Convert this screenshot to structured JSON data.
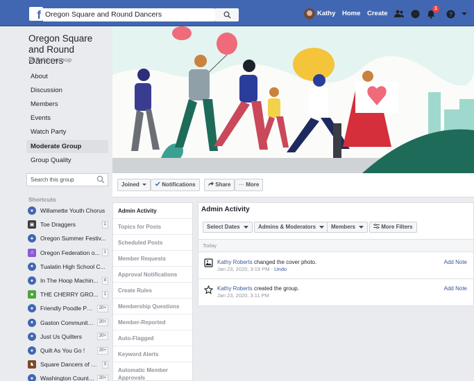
{
  "topbar": {
    "search_value": "Oregon Square and Round Dancers",
    "user_name": "Kathy",
    "home_label": "Home",
    "create_label": "Create",
    "notification_count": "1",
    "brand_color": "#4267b2"
  },
  "group": {
    "name": "Oregon Square and Round Dancers",
    "privacy": "Public group"
  },
  "nav": [
    {
      "label": "About"
    },
    {
      "label": "Discussion"
    },
    {
      "label": "Members"
    },
    {
      "label": "Events"
    },
    {
      "label": "Watch Party"
    },
    {
      "label": "Moderate Group"
    },
    {
      "label": "Group Quality"
    }
  ],
  "sidebar_search_placeholder": "Search this group",
  "shortcuts": {
    "heading": "Shortcuts",
    "items": [
      {
        "label": "Willamette Youth Chorus",
        "count": "",
        "icon": "group-icon"
      },
      {
        "label": "Toe Draggers",
        "count": "1",
        "icon": "photo-icon"
      },
      {
        "label": "Oregon Summer Festiv...",
        "count": "",
        "icon": "group-icon"
      },
      {
        "label": "Oregon Federation o...",
        "count": "1",
        "icon": "music-icon"
      },
      {
        "label": "Tualatin High School C...",
        "count": "",
        "icon": "group-icon"
      },
      {
        "label": "In The Hoop Machin...",
        "count": "4",
        "icon": "group-icon"
      },
      {
        "label": "THE CHERRY GRO...",
        "count": "1",
        "icon": "tree-icon"
      },
      {
        "label": "Friendly Poodle Pe...",
        "count": "20+",
        "icon": "group-icon"
      },
      {
        "label": "Gaston Community...",
        "count": "20+",
        "icon": "group-icon"
      },
      {
        "label": "Just Us Quilters",
        "count": "20+",
        "icon": "group-icon"
      },
      {
        "label": "Quilt As You Go !",
        "count": "20+",
        "icon": "group-icon"
      },
      {
        "label": "Square Dancers of O...",
        "count": "3",
        "icon": "dancer-icon"
      },
      {
        "label": "Washington County...",
        "count": "20+",
        "icon": "group-icon"
      }
    ]
  },
  "actions": {
    "joined": "Joined",
    "notifications": "Notifications",
    "share": "Share",
    "more": "More"
  },
  "admin_menu": [
    "Admin Activity",
    "Topics for Posts",
    "Scheduled Posts",
    "Member Requests",
    "Approval Notifications",
    "Create Rules",
    "Membership Questions",
    "Member-Reported",
    "Auto-Flagged",
    "Keyword Alerts",
    "Automatic Member Approvals"
  ],
  "panel": {
    "title": "Admin Activity",
    "filters": {
      "dates": "Select Dates",
      "admins": "Admins & Moderators",
      "members": "Members",
      "more": "More Filters"
    },
    "day_label": "Today",
    "entries": [
      {
        "actor": "Kathy Roberts",
        "action": "changed the cover photo.",
        "time": "Jan 23, 2020, 3:19 PM",
        "undo": "Undo",
        "note": "Add Note"
      },
      {
        "actor": "Kathy Roberts",
        "action": "created the group.",
        "time": "Jan 23, 2020, 3:11 PM",
        "undo": "",
        "note": "Add Note"
      }
    ]
  }
}
